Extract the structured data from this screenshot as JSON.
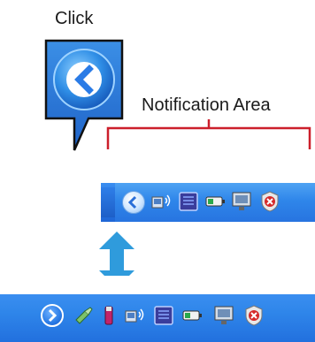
{
  "labels": {
    "click": "Click",
    "notification_area": "Notification Area"
  },
  "colors": {
    "bracket": "#cc1f2b",
    "arrow": "#2f9bdc",
    "taskbar": "#2b7be8"
  },
  "tray_collapsed": {
    "toggle_icon": "chevron-left-icon",
    "icons": [
      "network-wireless-icon",
      "network-card-icon",
      "battery-icon",
      "computer-icon",
      "security-shield-icon"
    ]
  },
  "tray_expanded": {
    "toggle_icon": "chevron-right-icon",
    "icons": [
      "connection-icon",
      "usb-drive-icon",
      "network-wireless-icon",
      "network-card-icon",
      "battery-icon",
      "computer-icon",
      "security-shield-icon"
    ]
  }
}
